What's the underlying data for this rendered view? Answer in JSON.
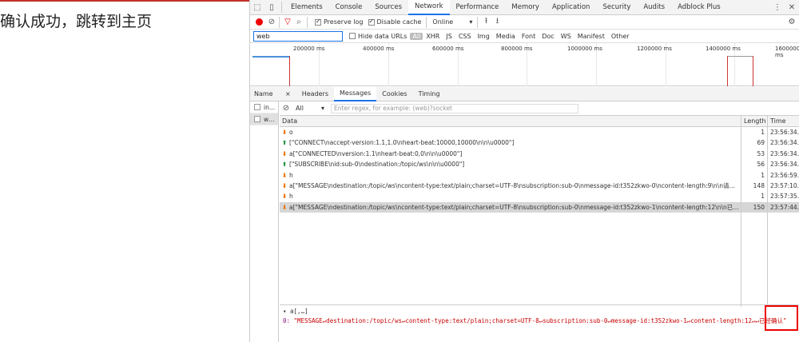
{
  "page": {
    "text": "确认成功，跳转到主页"
  },
  "devtools": {
    "tabs": [
      "Elements",
      "Console",
      "Sources",
      "Network",
      "Performance",
      "Memory",
      "Application",
      "Security",
      "Audits",
      "Adblock Plus"
    ],
    "active_tab": "Network",
    "toolbar": {
      "preserve_log": "Preserve log",
      "disable_cache": "Disable cache",
      "throttle": "Online"
    },
    "filter": {
      "value": "web",
      "hide_data_urls": "Hide data URLs",
      "types": [
        "All",
        "XHR",
        "JS",
        "CSS",
        "Img",
        "Media",
        "Font",
        "Doc",
        "WS",
        "Manifest",
        "Other"
      ]
    },
    "timeline": {
      "ticks": [
        "200000 ms",
        "400000 ms",
        "600000 ms",
        "800000 ms",
        "1000000 ms",
        "1200000 ms",
        "1400000 ms",
        "1600000 ms"
      ]
    },
    "requests": {
      "header": "Name",
      "rows": [
        "in…",
        "w…"
      ]
    },
    "subtabs": [
      "×",
      "Headers",
      "Messages",
      "Cookies",
      "Timing"
    ],
    "active_subtab": "Messages",
    "messages": {
      "filter_all": "All",
      "regex_placeholder": "Enter regex, for example: (web)?socket",
      "columns": {
        "data": "Data",
        "length": "Length",
        "time": "Time"
      },
      "rows": [
        {
          "dir": "down",
          "data": "o",
          "length": "1",
          "time": "23:56:34…"
        },
        {
          "dir": "up",
          "data": "[\"CONNECT\\naccept-version:1.1,1.0\\nheart-beat:10000,10000\\n\\n\\u0000\"]",
          "length": "69",
          "time": "23:56:34…"
        },
        {
          "dir": "down",
          "data": "a[\"CONNECTED\\nversion:1.1\\nheart-beat:0,0\\n\\n\\u0000\"]",
          "length": "53",
          "time": "23:56:34…"
        },
        {
          "dir": "up",
          "data": "[\"SUBSCRIBE\\nid:sub-0\\ndestination:/topic/ws\\n\\n\\u0000\"]",
          "length": "56",
          "time": "23:56:34…"
        },
        {
          "dir": "down",
          "data": "h",
          "length": "1",
          "time": "23:56:59…"
        },
        {
          "dir": "down",
          "data": "a[\"MESSAGE\\ndestination:/topic/ws\\ncontent-type:text/plain;charset=UTF-8\\nsubscription:sub-0\\nmessage-id:t352zkwo-0\\ncontent-length:9\\n\\n请确认\\u…",
          "length": "148",
          "time": "23:57:10…"
        },
        {
          "dir": "down",
          "data": "h",
          "length": "1",
          "time": "23:57:35…"
        },
        {
          "dir": "down",
          "data": "a[\"MESSAGE\\ndestination:/topic/ws\\ncontent-type:text/plain;charset=UTF-8\\nsubscription:sub-0\\nmessage-id:t352zkwo-1\\ncontent-length:12\\n\\n已经确…",
          "length": "150",
          "time": "23:57:44…"
        }
      ],
      "selected_index": 7
    },
    "detail": {
      "line1": "▾ a[,…]",
      "key": "0:",
      "value": "\"MESSAGE↵destination:/topic/ws↵content-type:text/plain;charset=UTF-8↵subscription:sub-0↵message-id:t352zkwo-1↵content-length:12↵↵",
      "highlight": "已经确认\""
    }
  }
}
